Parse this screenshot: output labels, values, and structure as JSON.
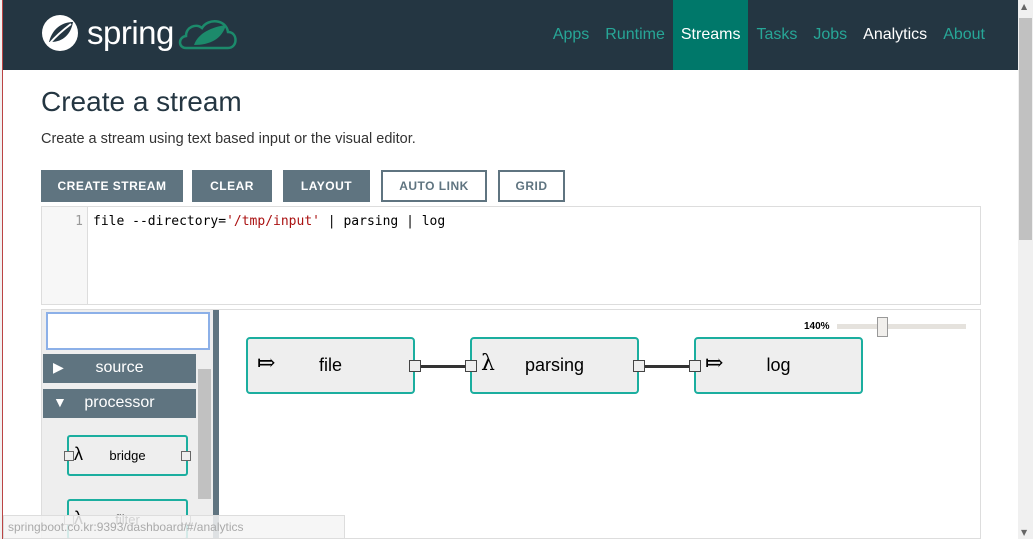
{
  "header": {
    "brand": "spring",
    "nav": [
      {
        "label": "Apps"
      },
      {
        "label": "Runtime"
      },
      {
        "label": "Streams",
        "active": true
      },
      {
        "label": "Tasks"
      },
      {
        "label": "Jobs"
      },
      {
        "label": "Analytics"
      },
      {
        "label": "About"
      }
    ]
  },
  "page": {
    "title": "Create a stream",
    "subtitle": "Create a stream using text based input or the visual editor."
  },
  "toolbar": {
    "create": "CREATE STREAM",
    "clear": "CLEAR",
    "layout": "LAYOUT",
    "auto_link": "AUTO LINK",
    "grid": "GRID"
  },
  "editor": {
    "line_number": "1",
    "code_pre": "file --directory=",
    "code_str": "'/tmp/input'",
    "code_post": " | parsing | log"
  },
  "palette": {
    "search_value": "",
    "groups": [
      {
        "label": "source",
        "expanded": false
      },
      {
        "label": "processor",
        "expanded": true
      }
    ],
    "items": [
      {
        "label": "bridge",
        "icon": "λ"
      },
      {
        "label": "filter",
        "icon": "λ"
      }
    ]
  },
  "canvas": {
    "zoom": "140%",
    "zoom_percent": 140,
    "nodes": [
      {
        "label": "file",
        "icon": "⤇"
      },
      {
        "label": "parsing",
        "icon": "λ"
      },
      {
        "label": "log",
        "icon": "⤇"
      }
    ]
  },
  "status": {
    "url": "springboot.co.kr:9393/dashboard/#/analytics"
  },
  "colors": {
    "header": "#243642",
    "accent": "#00786a",
    "teal": "#1bae9f",
    "button": "#5f7480"
  }
}
